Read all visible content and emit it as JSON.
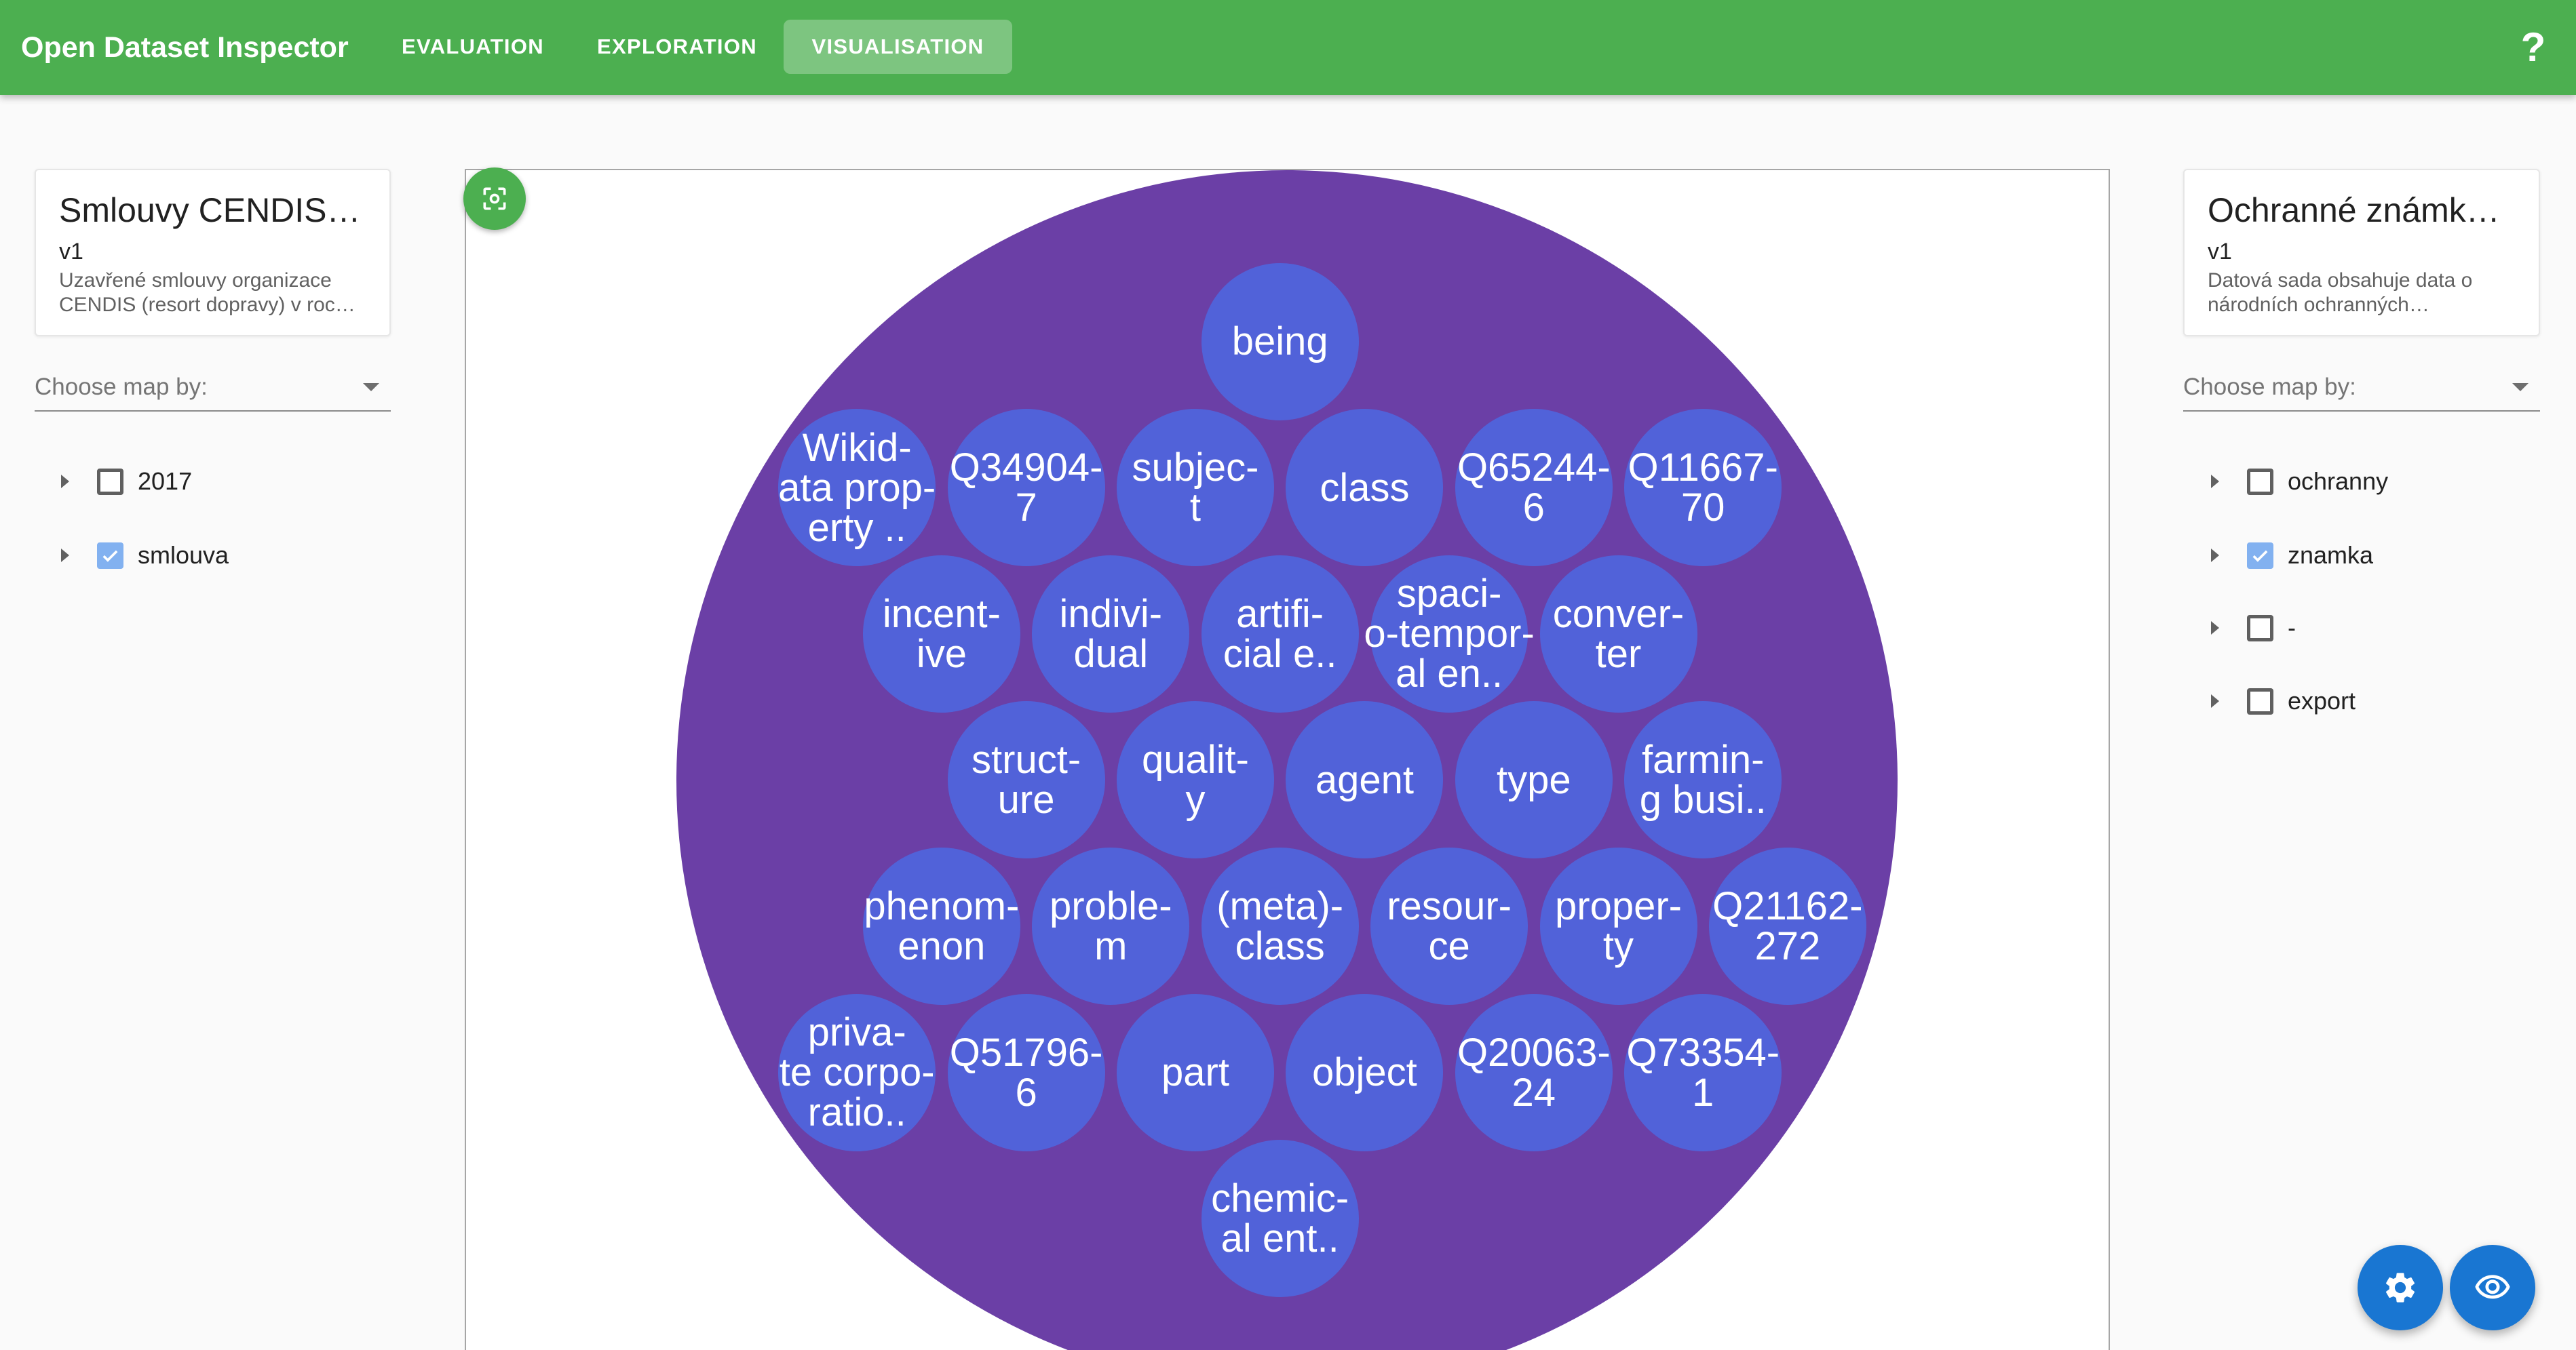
{
  "app": {
    "title": "Open Dataset Inspector",
    "help_label": "?"
  },
  "nav": {
    "tabs": [
      {
        "label": "EVALUATION",
        "active": false
      },
      {
        "label": "EXPLORATION",
        "active": false
      },
      {
        "label": "VISUALISATION",
        "active": true
      }
    ]
  },
  "left_panel": {
    "dataset": {
      "title": "Smlouvy CENDIS…",
      "version": "v1",
      "description": "Uzavřené smlouvy organizace\nCENDIS (resort dopravy) v roc…"
    },
    "map_select": {
      "label": "Choose map by:",
      "icon": "caret-down-icon"
    },
    "tree_toggle_icon": "caret-right-icon",
    "tree": [
      {
        "label": "2017",
        "checked": false
      },
      {
        "label": "smlouva",
        "checked": true
      }
    ]
  },
  "right_panel": {
    "dataset": {
      "title": "Ochranné známk…",
      "version": "v1",
      "description": "Datová sada obsahuje data o\nnárodních ochranných…"
    },
    "map_select": {
      "label": "Choose map by:",
      "icon": "caret-down-icon"
    },
    "tree_toggle_icon": "caret-right-icon",
    "tree": [
      {
        "label": "ochranny",
        "checked": false
      },
      {
        "label": "znamka",
        "checked": true
      },
      {
        "label": "-",
        "checked": false
      },
      {
        "label": "export",
        "checked": false
      }
    ]
  },
  "visualisation": {
    "focus_button_icon": "center-focus-icon",
    "colors": {
      "outer_bubble": "#6b3fa6",
      "node_bubble": "#5162d9",
      "node_text": "#ffffff"
    },
    "nodes": [
      {
        "label": "being"
      },
      {
        "label": "Wikid-\nata prop-\nerty .."
      },
      {
        "label": "Q34904-\n7"
      },
      {
        "label": "subjec-\nt"
      },
      {
        "label": "class"
      },
      {
        "label": "Q65244-\n6"
      },
      {
        "label": "Q11667-\n70"
      },
      {
        "label": "incent-\nive"
      },
      {
        "label": "indivi-\ndual"
      },
      {
        "label": "artifi-\ncial e.."
      },
      {
        "label": "spaci-\no-tempor-\nal en.."
      },
      {
        "label": "conver-\nter"
      },
      {
        "label": "struct-\nure"
      },
      {
        "label": "qualit-\ny"
      },
      {
        "label": "agent"
      },
      {
        "label": "type"
      },
      {
        "label": "farmin-\ng busi.."
      },
      {
        "label": "phenom-\nenon"
      },
      {
        "label": "proble-\nm"
      },
      {
        "label": "(meta)-\nclass"
      },
      {
        "label": "resour-\nce"
      },
      {
        "label": "proper-\nty"
      },
      {
        "label": "Q21162-\n272"
      },
      {
        "label": "priva-\nte corpo-\nratio.."
      },
      {
        "label": "Q51796-\n6"
      },
      {
        "label": "part"
      },
      {
        "label": "object"
      },
      {
        "label": "Q20063-\n24"
      },
      {
        "label": "Q73354-\n1"
      },
      {
        "label": "chemic-\nal ent.."
      }
    ]
  },
  "fabs": {
    "settings_icon": "gear-icon",
    "view_icon": "eye-icon"
  },
  "theme": {
    "primary": "#4caf50",
    "fab": "#1976d2",
    "checkbox_checked": "#82b1f0",
    "panel_border": "#a6a6a6"
  }
}
